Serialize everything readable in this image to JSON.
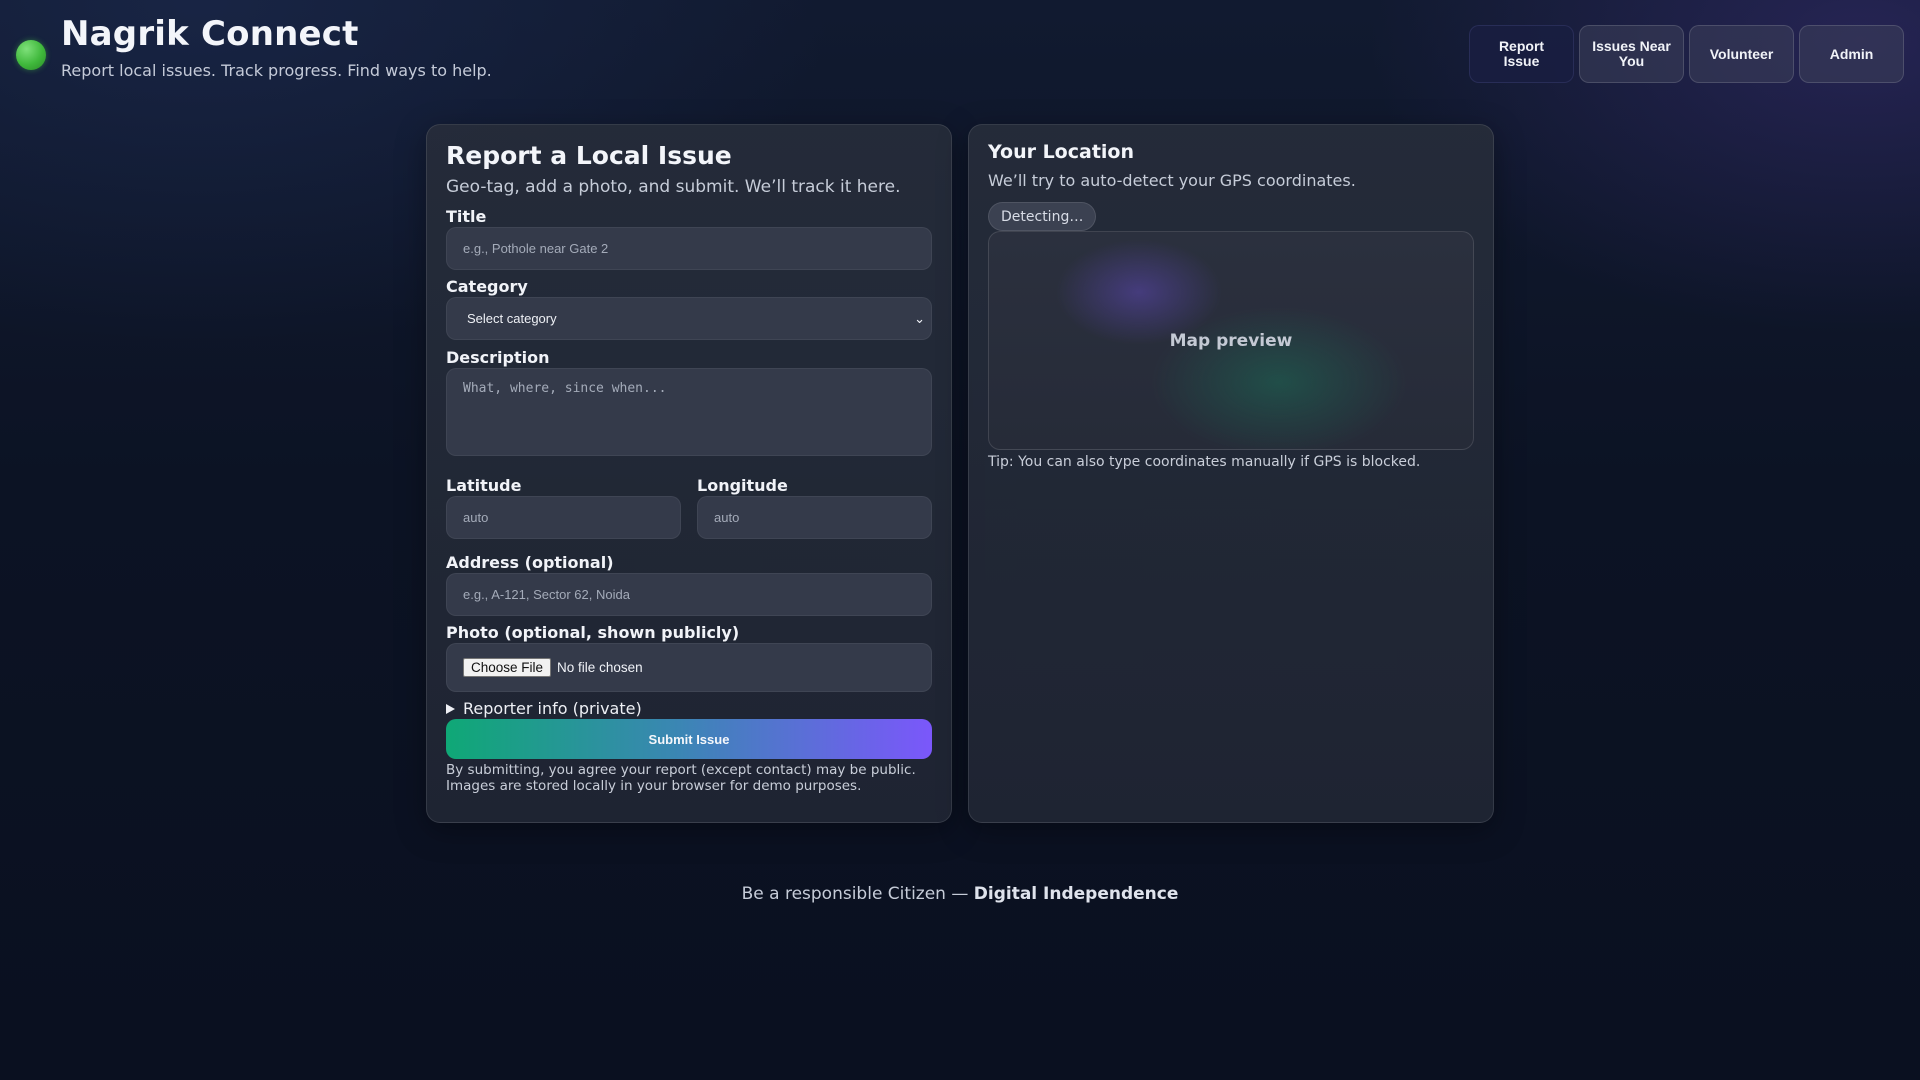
{
  "brand": {
    "title": "Nagrik Connect",
    "tagline": "Report local issues. Track progress. Find ways to help.",
    "logo_color": "#3fb83b"
  },
  "nav": [
    {
      "label": "Report Issue",
      "active": true
    },
    {
      "label": "Issues Near You",
      "active": false
    },
    {
      "label": "Volunteer",
      "active": false
    },
    {
      "label": "Admin",
      "active": false
    }
  ],
  "report_form": {
    "title": "Report a Local Issue",
    "subtitle": "Geo-tag, add a photo, and submit. We’ll track it here.",
    "title_field": {
      "label": "Title",
      "placeholder": "e.g., Pothole near Gate 2",
      "value": ""
    },
    "category_field": {
      "label": "Category",
      "selected": "Select category"
    },
    "description_field": {
      "label": "Description",
      "placeholder": "What, where, since when...",
      "value": ""
    },
    "latitude_field": {
      "label": "Latitude",
      "placeholder": "auto",
      "value": ""
    },
    "longitude_field": {
      "label": "Longitude",
      "placeholder": "auto",
      "value": ""
    },
    "address_field": {
      "label": "Address (optional)",
      "placeholder": "e.g., A-121, Sector 62, Noida",
      "value": ""
    },
    "photo_field": {
      "label": "Photo (optional, shown publicly)",
      "button_label": "Choose File",
      "status": "No file chosen"
    },
    "reporter_info_label": "Reporter info (private)",
    "submit_label": "Submit Issue",
    "disclaimer_line1": "By submitting, you agree your report (except contact) may be public.",
    "disclaimer_line2": "Images are stored locally in your browser for demo purposes."
  },
  "location_panel": {
    "title": "Your Location",
    "subtitle": "We’ll try to auto-detect your GPS coordinates.",
    "status": "Detecting…",
    "map_label": "Map preview",
    "tip": "Tip: You can also type coordinates manually if GPS is blocked."
  },
  "footer": {
    "text": "Be a responsible Citizen — ",
    "emphasis": "Digital Independence"
  },
  "colors": {
    "accent_start": "#0fa876",
    "accent_end": "#7b57fb",
    "background": "#0c1222"
  }
}
